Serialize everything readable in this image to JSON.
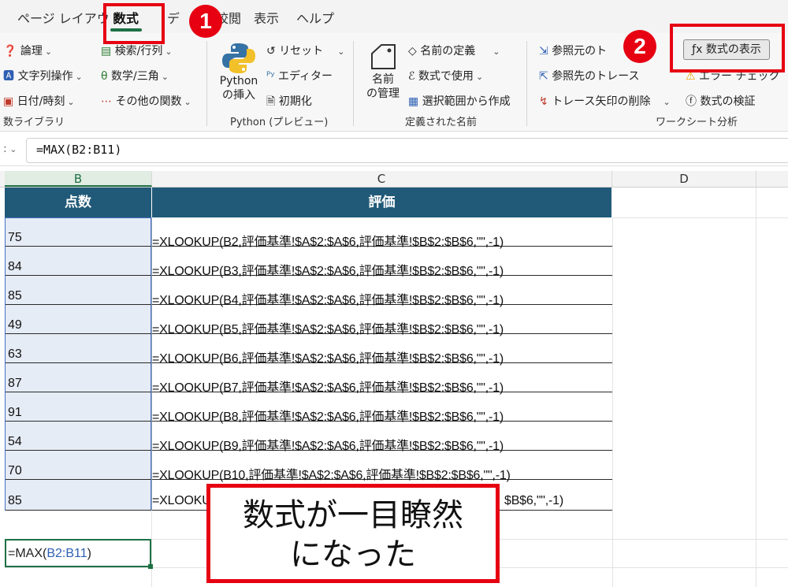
{
  "menu": {
    "tabs": [
      "ページ レイアウト",
      "数式",
      "デ",
      "校閲",
      "表示",
      "ヘルプ"
    ]
  },
  "ribbon": {
    "function_library": {
      "items": [
        "論理",
        "文字列操作",
        "日付/時刻",
        "検索/行列",
        "数学/三角",
        "その他の関数"
      ],
      "label": "数ライブラリ"
    },
    "python": {
      "insert_label_1": "Python",
      "insert_label_2": "の挿入",
      "reset": "リセット",
      "editor": "エディター",
      "initialize": "初期化",
      "label": "Python (プレビュー)"
    },
    "defined_names": {
      "manager_1": "名前",
      "manager_2": "の管理",
      "define_name": "名前の定義",
      "use_in_formula": "数式で使用",
      "create_from_selection": "選択範囲から作成",
      "label": "定義された名前"
    },
    "formula_auditing": {
      "trace_precedents": "参照元のト",
      "trace_dependents": "参照先のトレース",
      "remove_arrows": "トレース矢印の削除",
      "show_formulas": "数式の表示",
      "error_checking": "エラー チェック",
      "evaluate_formula": "数式の検証",
      "label": "ワークシート分析"
    }
  },
  "formula_bar": {
    "namebox_tail": ":",
    "formula": "=MAX(B2:B11)"
  },
  "sheet": {
    "columns": [
      "B",
      "C",
      "D"
    ],
    "header": {
      "score": "点数",
      "rating": "評価"
    },
    "rows": [
      {
        "score": "75",
        "formula": "=XLOOKUP(B2,評価基準!$A$2:$A$6,評価基準!$B$2:$B$6,\"\",-1)"
      },
      {
        "score": "84",
        "formula": "=XLOOKUP(B3,評価基準!$A$2:$A$6,評価基準!$B$2:$B$6,\"\",-1)"
      },
      {
        "score": "85",
        "formula": "=XLOOKUP(B4,評価基準!$A$2:$A$6,評価基準!$B$2:$B$6,\"\",-1)"
      },
      {
        "score": "49",
        "formula": "=XLOOKUP(B5,評価基準!$A$2:$A$6,評価基準!$B$2:$B$6,\"\",-1)"
      },
      {
        "score": "63",
        "formula": "=XLOOKUP(B6,評価基準!$A$2:$A$6,評価基準!$B$2:$B$6,\"\",-1)"
      },
      {
        "score": "87",
        "formula": "=XLOOKUP(B7,評価基準!$A$2:$A$6,評価基準!$B$2:$B$6,\"\",-1)"
      },
      {
        "score": "91",
        "formula": "=XLOOKUP(B8,評価基準!$A$2:$A$6,評価基準!$B$2:$B$6,\"\",-1)"
      },
      {
        "score": "54",
        "formula": "=XLOOKUP(B9,評価基準!$A$2:$A$6,評価基準!$B$2:$B$6,\"\",-1)"
      },
      {
        "score": "70",
        "formula": "=XLOOKUP(B10,評価基準!$A$2:$A$6,評価基準!$B$2:$B$6,\"\",-1)"
      },
      {
        "score": "85",
        "formula": "=XLOOKUP("
      }
    ],
    "row10_tail": "$B$6,\"\",-1)",
    "max_cell": {
      "prefix": "=MAX(",
      "ref": "B2:B11",
      "suffix": ")"
    }
  },
  "annotations": {
    "badge_1": "1",
    "badge_2": "2",
    "callout_line1": "数式が一目瞭然",
    "callout_line2": "になった"
  },
  "colors": {
    "accent_green": "#1e7145",
    "header_fill": "#215a78",
    "annotation_red": "#e60012"
  }
}
